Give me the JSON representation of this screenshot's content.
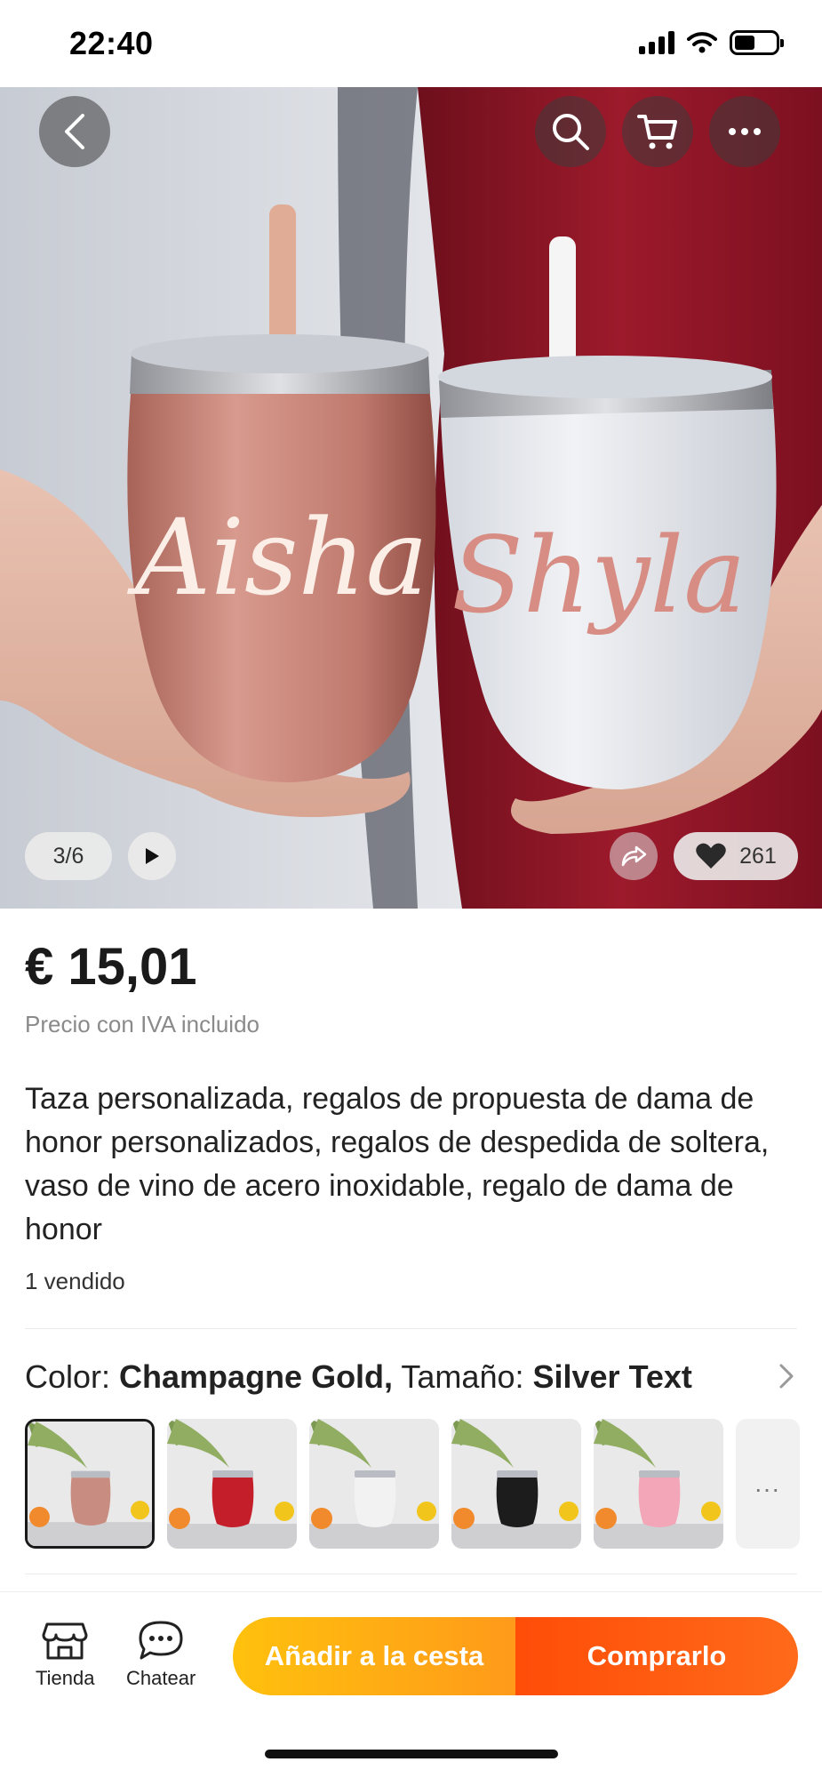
{
  "status_bar": {
    "time": "22:40"
  },
  "gallery": {
    "counter": "3/6",
    "likes": "261",
    "cup_left_name": "Aisha",
    "cup_right_name": "Shyla"
  },
  "product": {
    "price": "€ 15,01",
    "vat_note": "Precio con IVA incluido",
    "title": "Taza personalizada, regalos de propuesta de dama de honor personalizados, regalos de despedida de soltera, vaso de vino de acero inoxidable, regalo de dama de honor",
    "sold": "1 vendido"
  },
  "variant": {
    "color_label": "Color: ",
    "color_value": "Champagne Gold,",
    "size_label": " Tamaño: ",
    "size_value": "Silver Text",
    "swatches": [
      "#c98c80",
      "#c41e2a",
      "#f2f2f2",
      "#1c1c1c",
      "#f2a6b8"
    ],
    "more": "..."
  },
  "bottom_bar": {
    "store_label": "Tienda",
    "chat_label": "Chatear",
    "add_to_cart": "Añadir a la cesta",
    "buy_now": "Comprarlo"
  },
  "colors": {
    "accent_yellow": "#ffc10d",
    "accent_orange": "#ff4d08"
  },
  "icons": [
    "back-icon",
    "search-icon",
    "cart-icon",
    "more-icon",
    "play-icon",
    "share-icon",
    "heart-icon",
    "chevron-right-icon",
    "store-icon",
    "chat-icon"
  ]
}
